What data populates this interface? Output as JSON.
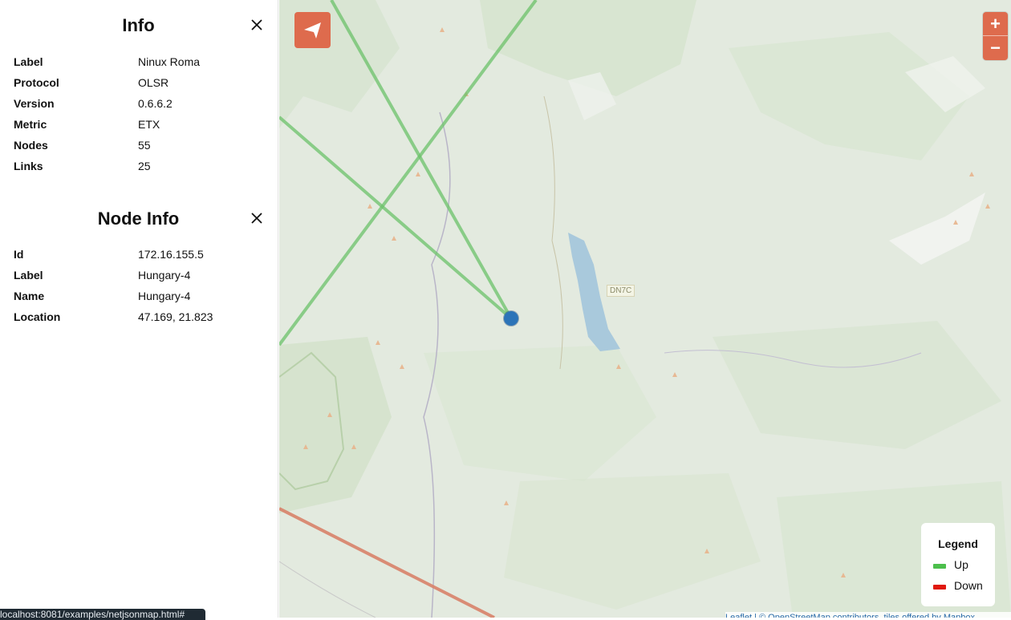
{
  "info_panel": {
    "title": "Info",
    "rows": [
      {
        "key": "Label",
        "value": "Ninux Roma"
      },
      {
        "key": "Protocol",
        "value": "OLSR"
      },
      {
        "key": "Version",
        "value": "0.6.6.2"
      },
      {
        "key": "Metric",
        "value": "ETX"
      },
      {
        "key": "Nodes",
        "value": "55"
      },
      {
        "key": "Links",
        "value": "25"
      }
    ]
  },
  "node_panel": {
    "title": "Node Info",
    "rows": [
      {
        "key": "Id",
        "value": "172.16.155.5"
      },
      {
        "key": "Label",
        "value": "Hungary-4"
      },
      {
        "key": "Name",
        "value": "Hungary-4"
      },
      {
        "key": "Location",
        "value": "47.169, 21.823"
      }
    ]
  },
  "map": {
    "road_label": "DN7C",
    "zoom_in": "+",
    "zoom_out": "−",
    "attribution": "Leaflet | © OpenStreetMap contributors, tiles offered by Mapbox"
  },
  "legend": {
    "title": "Legend",
    "items": [
      {
        "label": "Up",
        "color": "#4cbf4c"
      },
      {
        "label": "Down",
        "color": "#e0190c"
      }
    ]
  },
  "statusbar": {
    "text": "localhost:8081/examples/netjsonmap.html#"
  },
  "colors": {
    "accent": "#de6b4d",
    "link_up": "#6cc26a",
    "link_down": "#d9826a",
    "node": "#2c74b8"
  },
  "icons": {
    "sidebar_toggle": "send-arrow-icon",
    "close": "close-icon"
  }
}
